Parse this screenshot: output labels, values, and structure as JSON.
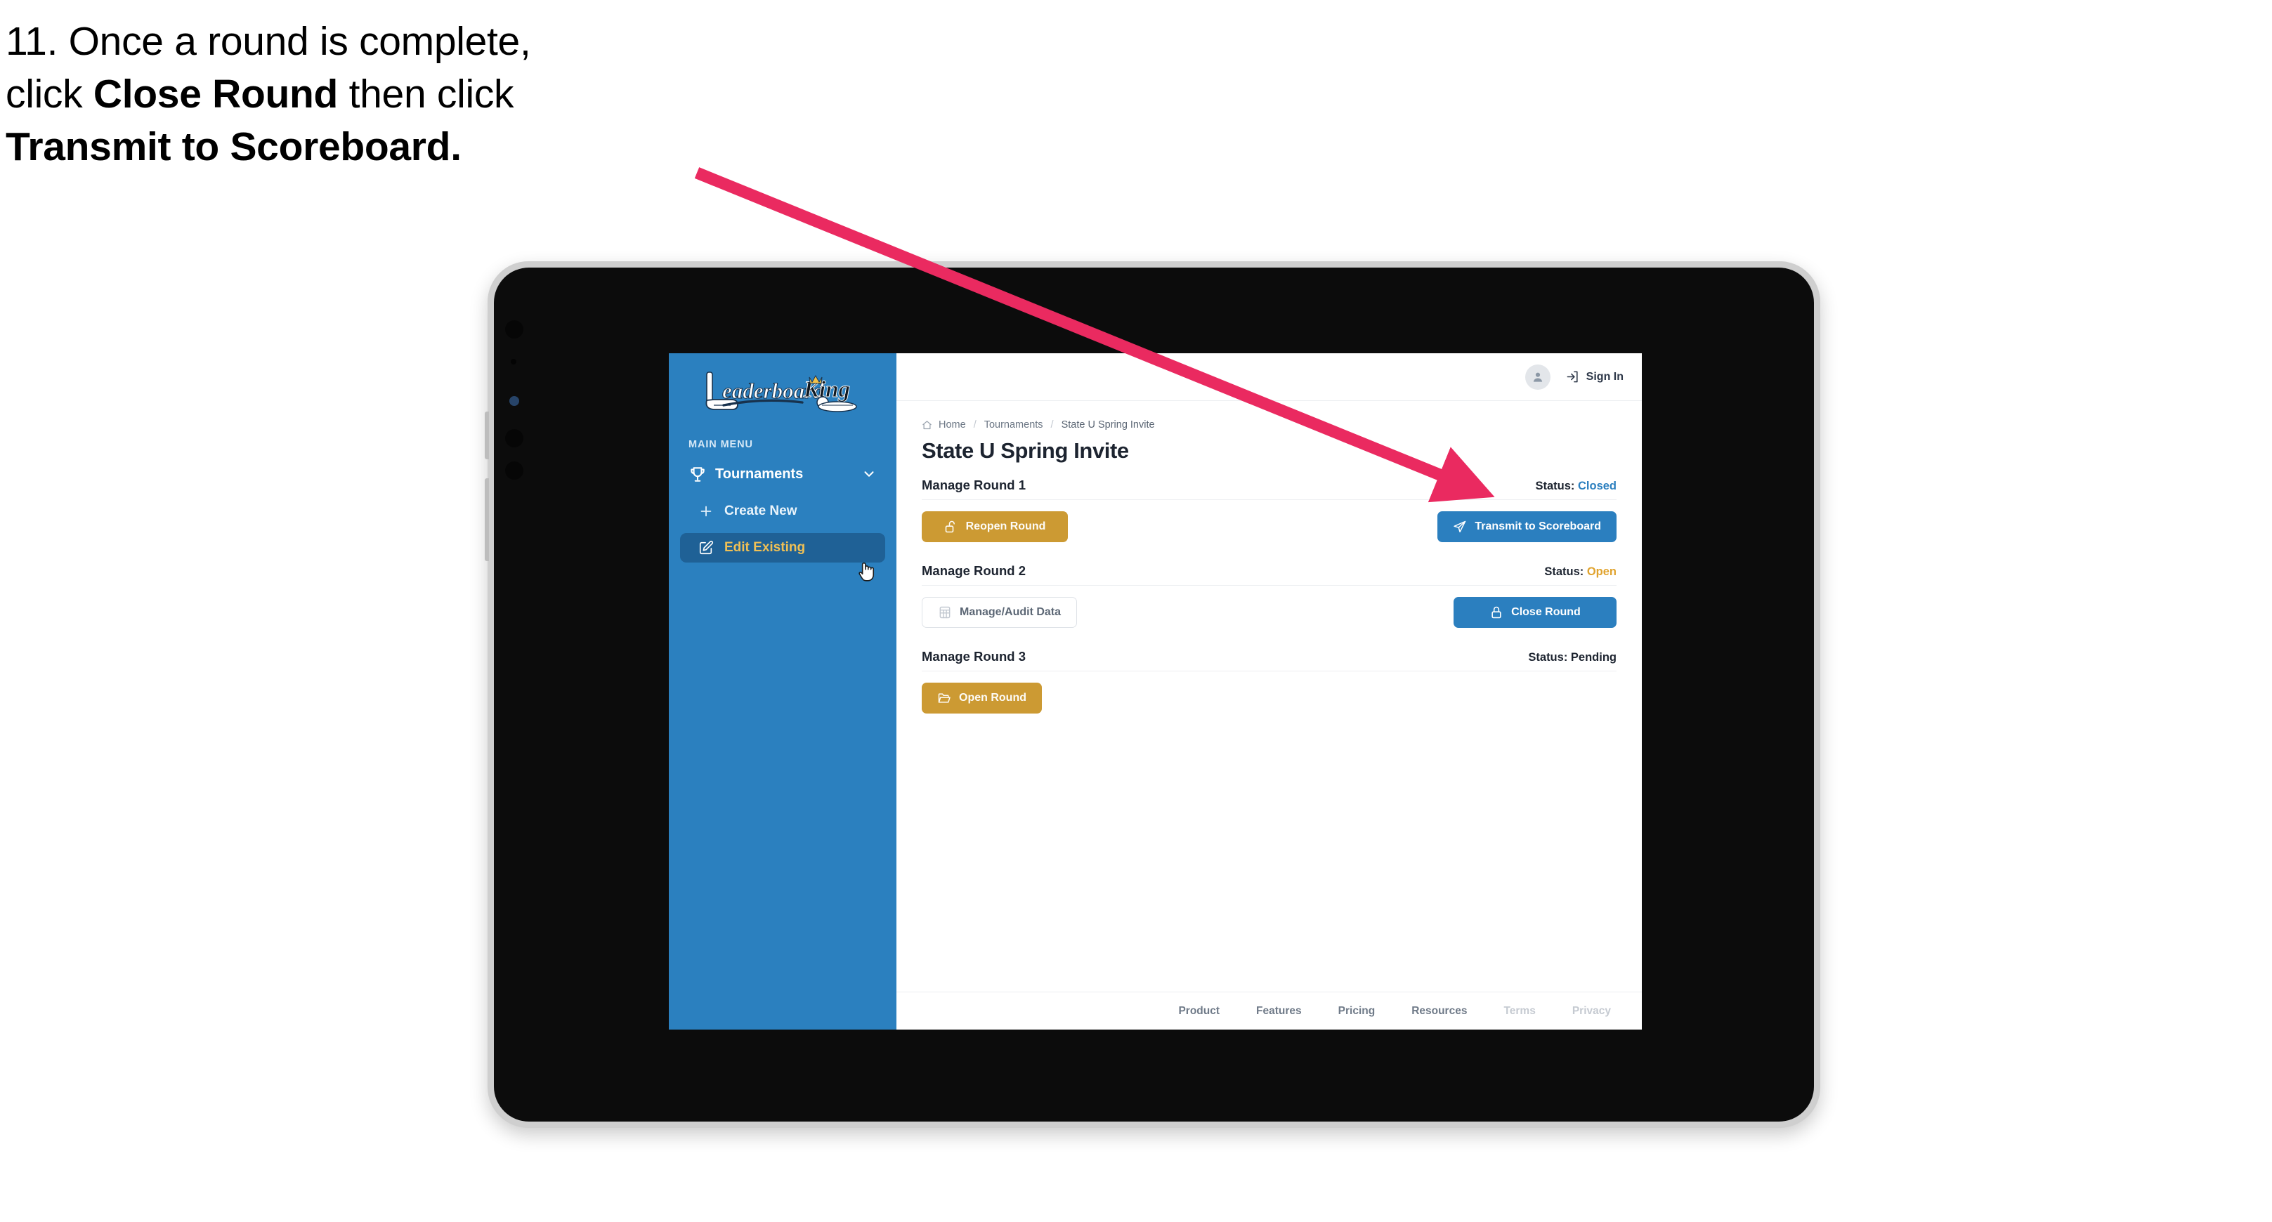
{
  "caption": {
    "line1": "11. Once a round is complete,",
    "line2_pre": "click ",
    "line2_bold": "Close Round",
    "line2_post": " then click",
    "line3_bold": "Transmit to Scoreboard."
  },
  "annotation": {
    "arrow_color": "#ea2a60"
  },
  "sidebar": {
    "brand": {
      "word1": "eaderboard",
      "word2": "King",
      "initial": "L"
    },
    "section_label": "MAIN MENU",
    "nav": {
      "label": "Tournaments",
      "icon": "trophy-icon",
      "chevron": "chevron-down-icon"
    },
    "items": [
      {
        "label": "Create New",
        "icon": "plus-icon",
        "active": false
      },
      {
        "label": "Edit Existing",
        "icon": "edit-pencil-icon",
        "active": true
      }
    ],
    "bg_color": "#2b80bf",
    "active_bg": "#1f6196",
    "active_text": "#f0c055"
  },
  "header": {
    "avatar_icon": "user-avatar-icon",
    "signin_icon": "login-arrow-icon",
    "signin_label": "Sign In"
  },
  "breadcrumb": {
    "home_icon": "home-icon",
    "items": [
      "Home",
      "Tournaments",
      "State U Spring Invite"
    ],
    "separator": "/"
  },
  "page": {
    "title": "State U Spring Invite"
  },
  "rounds": [
    {
      "name": "Manage Round 1",
      "status_label": "Status:",
      "status_value": "Closed",
      "status_class": "st-closed",
      "left_button": {
        "label": "Reopen Round",
        "icon": "unlock-icon",
        "style": "btn-gold",
        "width": "w-reopen"
      },
      "right_button": {
        "label": "Transmit to Scoreboard",
        "icon": "send-plane-icon",
        "style": "btn-blue",
        "width": "w-transmit"
      }
    },
    {
      "name": "Manage Round 2",
      "status_label": "Status:",
      "status_value": "Open",
      "status_class": "st-open",
      "left_button": {
        "label": "Manage/Audit Data",
        "icon": "table-grid-icon",
        "style": "btn-ghost",
        "width": "w-audit"
      },
      "right_button": {
        "label": "Close Round",
        "icon": "lock-icon",
        "style": "btn-blue",
        "width": "w-close"
      }
    },
    {
      "name": "Manage Round 3",
      "status_label": "Status:",
      "status_value": "Pending",
      "status_class": "st-pending",
      "left_button": {
        "label": "Open Round",
        "icon": "open-folder-icon",
        "style": "btn-gold",
        "width": "w-open"
      },
      "right_button": null
    }
  ],
  "footer": {
    "links": [
      {
        "label": "Product",
        "muted": false
      },
      {
        "label": "Features",
        "muted": false
      },
      {
        "label": "Pricing",
        "muted": false
      },
      {
        "label": "Resources",
        "muted": false
      },
      {
        "label": "Terms",
        "muted": true
      },
      {
        "label": "Privacy",
        "muted": true
      }
    ]
  },
  "colors": {
    "brand_blue": "#2b7fbf",
    "brand_gold": "#cc9a33",
    "status_open": "#e0a32e",
    "status_closed": "#2b7fbf"
  }
}
